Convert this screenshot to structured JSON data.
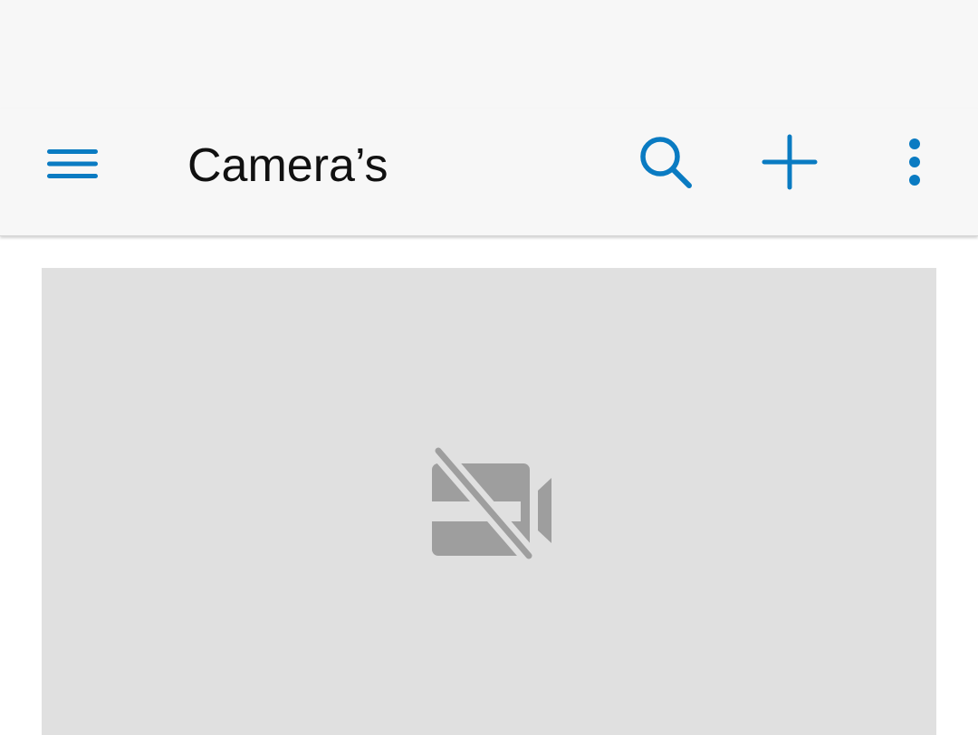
{
  "header": {
    "title": "Camera’s"
  },
  "icons": {
    "menu": "hamburger-menu-icon",
    "search": "search-icon",
    "add": "plus-icon",
    "more": "more-vertical-icon",
    "camera_off": "video-off-icon"
  },
  "colors": {
    "accent": "#0a7bc2",
    "app_bar_bg": "#f7f7f7",
    "tile_bg": "#e0e0e0",
    "placeholder_icon": "#9e9e9e"
  }
}
